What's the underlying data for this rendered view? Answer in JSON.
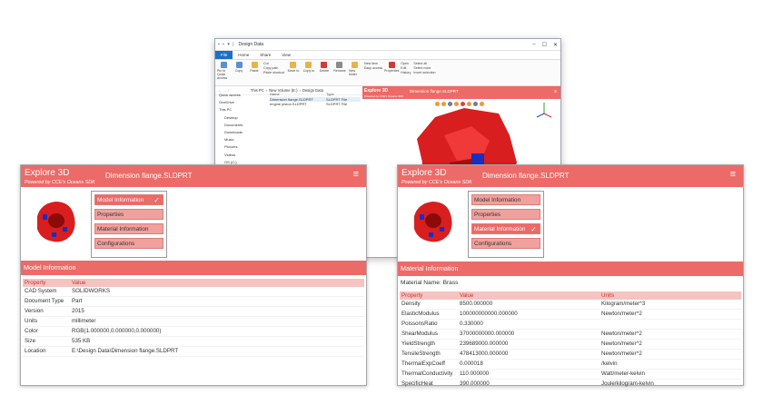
{
  "explorer": {
    "title": "Design Data",
    "tabs": [
      "File",
      "Home",
      "Share",
      "View"
    ],
    "ribbon": {
      "pin": "Pin to Quick access",
      "copy": "Copy",
      "paste": "Paste",
      "cut": "Cut",
      "copy_path": "Copy path",
      "paste_shortcut": "Paste shortcut",
      "move_to": "Move to",
      "copy_to": "Copy to",
      "delete": "Delete",
      "rename": "Rename",
      "new_folder": "New folder",
      "new_item": "New item",
      "easy_access": "Easy access",
      "properties": "Properties",
      "open": "Open",
      "edit": "Edit",
      "history": "History",
      "select_all": "Select all",
      "select_none": "Select none",
      "invert_selection": "Invert selection",
      "groups": [
        "Clipboard",
        "Organize",
        "New",
        "Open",
        "Select"
      ]
    },
    "address": [
      "This PC",
      "New Volume (E:)",
      "Design Data"
    ],
    "nav": [
      "Quick access",
      "OneDrive",
      "This PC",
      "Desktop",
      "Documents",
      "Downloads",
      "Music",
      "Pictures",
      "Videos",
      "OS (C:)",
      "New Volume (E:)",
      "Network"
    ],
    "files_header": [
      "Name",
      "Type"
    ],
    "files": [
      {
        "name": "Dimension flange.SLDPRT",
        "type": "SLDPRT File"
      },
      {
        "name": "engine piston.SLDPRT",
        "type": "SLDPRT File"
      }
    ],
    "preview": {
      "title": "Explore 3D",
      "subtitle": "Powered by CCE's Oceans SDK",
      "file": "Dimension flange.SLDPRT"
    }
  },
  "left_window": {
    "title": "Explore 3D",
    "subtitle": "Powered by CCE's Oceans SDK",
    "file": "Dimension flange.SLDPRT",
    "menu_icon": "≡",
    "menu": [
      "Model Information",
      "Properties",
      "Material Information",
      "Configurations"
    ],
    "active": "Model Information",
    "section": "Model Information",
    "columns": [
      "Property",
      "Value"
    ],
    "rows": [
      [
        "CAD System",
        "SOLIDWORKS"
      ],
      [
        "Document Type",
        "Part"
      ],
      [
        "Version",
        "2015"
      ],
      [
        "Units",
        "millimeter"
      ],
      [
        "Color",
        "RGB(1.000000,0.000000,0.000000)"
      ],
      [
        "Size",
        "535 KB"
      ],
      [
        "Location",
        "E:\\Design Data\\Dimension flange.SLDPRT"
      ]
    ]
  },
  "right_window": {
    "title": "Explore 3D",
    "subtitle": "Powered by CCE's Oceans SDK",
    "file": "Dimension flange.SLDPRT",
    "menu_icon": "≡",
    "menu": [
      "Model Information",
      "Properties",
      "Material Information",
      "Configurations"
    ],
    "active": "Material Information",
    "section": "Material Information",
    "material_label": "Material Name:",
    "material_value": "Brass",
    "columns": [
      "Property",
      "Value",
      "Units"
    ],
    "rows": [
      [
        "Density",
        "8500.000000",
        "Kilogram/meter^3"
      ],
      [
        "ElasticModulus",
        "100000000000.000000",
        "Newton/meter^2"
      ],
      [
        "PoissonsRatio",
        "0.330000",
        ""
      ],
      [
        "ShearModulus",
        "37000000000.000000",
        "Newton/meter^2"
      ],
      [
        "YieldStrength",
        "239689000.000000",
        "Newton/meter^2"
      ],
      [
        "TensileStrength",
        "478413000.000000",
        "Newton/meter^2"
      ],
      [
        "ThermalExpCoeff",
        "0.000018",
        "/kelvin"
      ],
      [
        "ThermalConductivity",
        "110.000000",
        "Watt/meter-kelvin"
      ],
      [
        "SpecificHeat",
        "390.000000",
        "Joule/kilogram-kelvin"
      ]
    ]
  },
  "colors": {
    "accent": "#ec6a67",
    "menu_item": "#f0a19d",
    "header_row": "#f5c3c0",
    "model_red": "#d81e1e",
    "model_blue": "#1a2fbf"
  }
}
